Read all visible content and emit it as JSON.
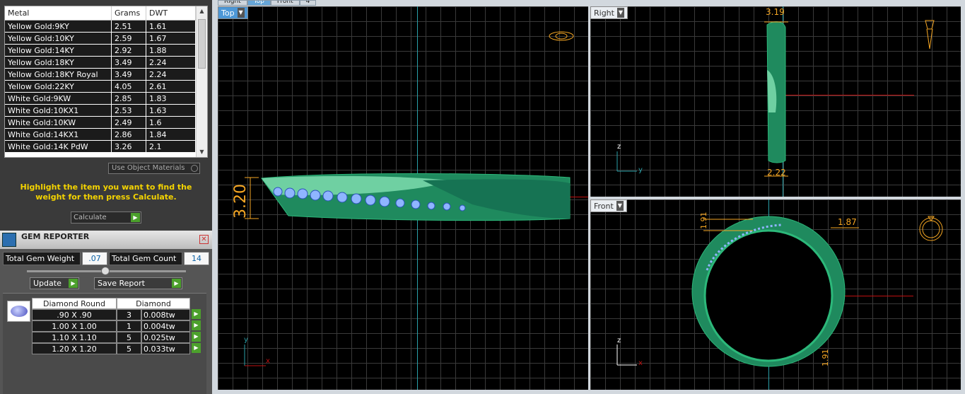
{
  "metal_table": {
    "headers": [
      "Metal",
      "Grams",
      "DWT"
    ],
    "rows": [
      [
        "Yellow Gold:9KY",
        "2.51",
        "1.61"
      ],
      [
        "Yellow Gold:10KY",
        "2.59",
        "1.67"
      ],
      [
        "Yellow Gold:14KY",
        "2.92",
        "1.88"
      ],
      [
        "Yellow Gold:18KY",
        "3.49",
        "2.24"
      ],
      [
        "Yellow Gold:18KY Royal",
        "3.49",
        "2.24"
      ],
      [
        "Yellow Gold:22KY",
        "4.05",
        "2.61"
      ],
      [
        "White Gold:9KW",
        "2.85",
        "1.83"
      ],
      [
        "White Gold:10KX1",
        "2.53",
        "1.63"
      ],
      [
        "White Gold:10KW",
        "2.49",
        "1.6"
      ],
      [
        "White Gold:14KX1",
        "2.86",
        "1.84"
      ],
      [
        "White Gold:14K PdW",
        "3.26",
        "2.1"
      ]
    ]
  },
  "use_object_materials": "Use Object Materials",
  "hint": "Highlight the item you want to find the weight for then press Calculate.",
  "calculate": "Calculate",
  "gem_reporter": {
    "title": "GEM REPORTER",
    "total_weight_label": "Total Gem Weight",
    "total_weight": ".07",
    "total_count_label": "Total Gem Count",
    "total_count": "14",
    "update": "Update",
    "save_report": "Save Report",
    "col1": "Diamond Round",
    "col2": "Diamond",
    "rows": [
      [
        ".90 X .90",
        "3",
        "0.008tw"
      ],
      [
        "1.00 X 1.00",
        "1",
        "0.004tw"
      ],
      [
        "1.10 X 1.10",
        "5",
        "0.025tw"
      ],
      [
        "1.20 X 1.20",
        "5",
        "0.033tw"
      ]
    ]
  },
  "tabs": [
    "Right",
    "Top",
    "Front",
    "4"
  ],
  "views": {
    "top": {
      "label": "Top",
      "dim": "3.20",
      "axis_y": "y",
      "axis_x": "x"
    },
    "right": {
      "label": "Right",
      "dim_top": "3.19",
      "dim_bottom": "2.22",
      "axis_z": "z",
      "axis_y": "y"
    },
    "front": {
      "label": "Front",
      "dim_left": "1.91",
      "dim_right": "1.87",
      "dim_bottom": "1.91",
      "axis_z": "z",
      "axis_x": "x"
    }
  }
}
